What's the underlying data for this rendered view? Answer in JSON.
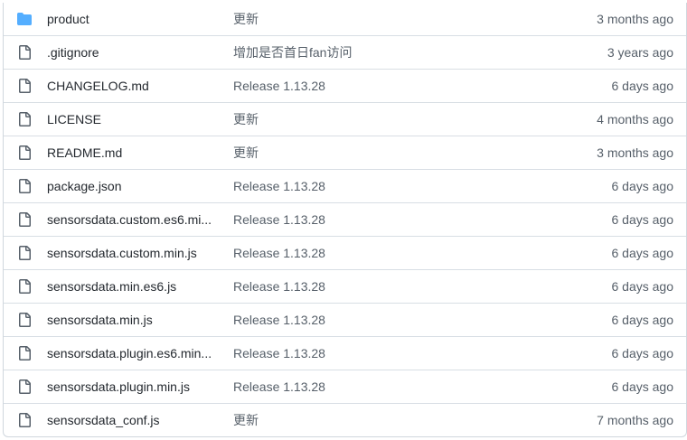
{
  "colors": {
    "folder": "#54aeff",
    "file_icon": "#57606a",
    "border": "#d0d7de",
    "muted_text": "#57606a",
    "text": "#24292f"
  },
  "files": [
    {
      "type": "folder",
      "icon": "folder-icon",
      "name": "product",
      "message": "更新",
      "age": "3 months ago"
    },
    {
      "type": "file",
      "icon": "file-icon",
      "name": ".gitignore",
      "message": "增加是否首日fan访问",
      "age": "3 years ago"
    },
    {
      "type": "file",
      "icon": "file-icon",
      "name": "CHANGELOG.md",
      "message": "Release 1.13.28",
      "age": "6 days ago"
    },
    {
      "type": "file",
      "icon": "file-icon",
      "name": "LICENSE",
      "message": "更新",
      "age": "4 months ago"
    },
    {
      "type": "file",
      "icon": "file-icon",
      "name": "README.md",
      "message": "更新",
      "age": "3 months ago"
    },
    {
      "type": "file",
      "icon": "file-icon",
      "name": "package.json",
      "message": "Release 1.13.28",
      "age": "6 days ago"
    },
    {
      "type": "file",
      "icon": "file-icon",
      "name": "sensorsdata.custom.es6.mi...",
      "message": "Release 1.13.28",
      "age": "6 days ago"
    },
    {
      "type": "file",
      "icon": "file-icon",
      "name": "sensorsdata.custom.min.js",
      "message": "Release 1.13.28",
      "age": "6 days ago"
    },
    {
      "type": "file",
      "icon": "file-icon",
      "name": "sensorsdata.min.es6.js",
      "message": "Release 1.13.28",
      "age": "6 days ago"
    },
    {
      "type": "file",
      "icon": "file-icon",
      "name": "sensorsdata.min.js",
      "message": "Release 1.13.28",
      "age": "6 days ago"
    },
    {
      "type": "file",
      "icon": "file-icon",
      "name": "sensorsdata.plugin.es6.min...",
      "message": "Release 1.13.28",
      "age": "6 days ago"
    },
    {
      "type": "file",
      "icon": "file-icon",
      "name": "sensorsdata.plugin.min.js",
      "message": "Release 1.13.28",
      "age": "6 days ago"
    },
    {
      "type": "file",
      "icon": "file-icon",
      "name": "sensorsdata_conf.js",
      "message": "更新",
      "age": "7 months ago"
    }
  ]
}
